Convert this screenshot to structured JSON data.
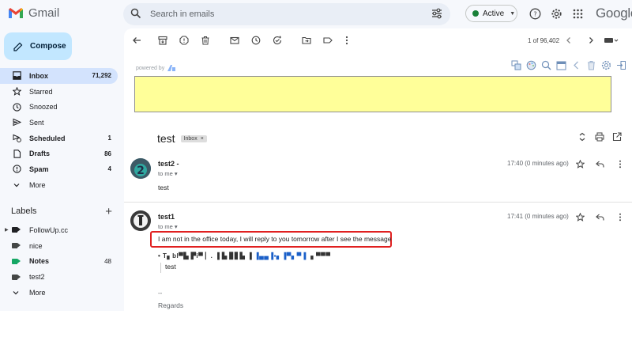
{
  "app": {
    "name": "Gmail"
  },
  "header": {
    "search_placeholder": "Search in emails",
    "status_label": "Active",
    "google_label": "Google"
  },
  "sidebar": {
    "compose_label": "Compose",
    "items": [
      {
        "label": "Inbox",
        "count": "71,292",
        "icon": "inbox-icon"
      },
      {
        "label": "Starred",
        "count": "",
        "icon": "star-icon"
      },
      {
        "label": "Snoozed",
        "count": "",
        "icon": "clock-icon"
      },
      {
        "label": "Sent",
        "count": "",
        "icon": "send-icon"
      },
      {
        "label": "Scheduled",
        "count": "1",
        "icon": "schedule-send-icon"
      },
      {
        "label": "Drafts",
        "count": "86",
        "icon": "draft-icon"
      },
      {
        "label": "Spam",
        "count": "4",
        "icon": "spam-icon"
      },
      {
        "label": "More",
        "count": "",
        "icon": "chevron-down-icon"
      }
    ],
    "labels_heading": "Labels",
    "labels": [
      {
        "label": "FollowUp.cc",
        "count": "",
        "color": "#202124"
      },
      {
        "label": "nice",
        "count": "",
        "color": "#444746"
      },
      {
        "label": "Notes",
        "count": "48",
        "color": "#16a765"
      },
      {
        "label": "test2",
        "count": "",
        "color": "#444746"
      },
      {
        "label": "More",
        "count": ""
      }
    ]
  },
  "toolbar": {
    "pager": "1 of 96,402"
  },
  "extension": {
    "powered_by": "powered by"
  },
  "thread": {
    "subject": "test",
    "chip_label": "Inbox",
    "chip_close": "×",
    "messages": [
      {
        "sender": "test2 -",
        "to": "to me",
        "time": "17:40 (0 minutes ago)",
        "body": "test"
      },
      {
        "sender": "test1",
        "to": "to me",
        "time": "17:41 (0 minutes ago)",
        "body": "I am not in the office today, I will reply to you tomorrow after I see the message",
        "quoted_header": "• T▖bl▀▙ ▛i▀ ▏.  ▐ ▙ ▊▋▙ ▐ ",
        "quoted_link": "▐▄▄▐▪▖▐▀▖▀ ▌",
        "quoted_tail": " ▖▀▀▀",
        "quoted_body": "test",
        "signature_dash": "--",
        "signature": "Regards"
      }
    ]
  },
  "colors": {
    "highlight_border": "#e02020",
    "addon_box": "#ffff99",
    "compose_bg": "#c2e7ff",
    "active_nav": "#d3e3fd"
  }
}
